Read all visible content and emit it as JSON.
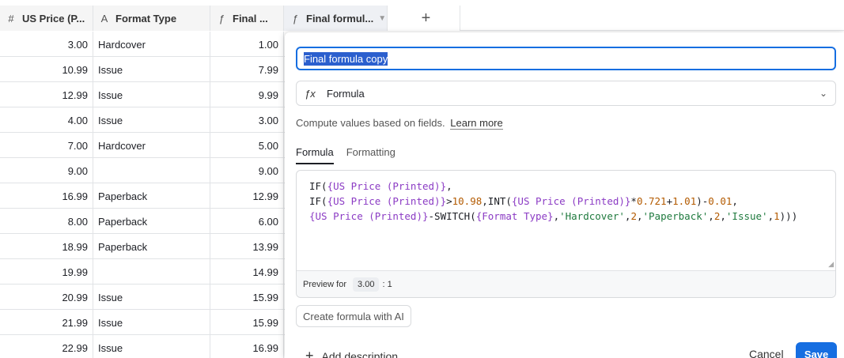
{
  "columns": [
    {
      "icon": "#",
      "label": "US Price (P..."
    },
    {
      "icon": "A",
      "label": "Format Type"
    },
    {
      "icon": "fx",
      "label": "Final ..."
    },
    {
      "icon": "fx",
      "label": "Final formul..."
    }
  ],
  "add_column_label": "+",
  "rows": [
    {
      "price": "3.00",
      "format": "Hardcover",
      "final": "1.00"
    },
    {
      "price": "10.99",
      "format": "Issue",
      "final": "7.99"
    },
    {
      "price": "12.99",
      "format": "Issue",
      "final": "9.99"
    },
    {
      "price": "4.00",
      "format": "Issue",
      "final": "3.00"
    },
    {
      "price": "7.00",
      "format": "Hardcover",
      "final": "5.00"
    },
    {
      "price": "9.00",
      "format": "",
      "final": "9.00"
    },
    {
      "price": "16.99",
      "format": "Paperback",
      "final": "12.99"
    },
    {
      "price": "8.00",
      "format": "Paperback",
      "final": "6.00"
    },
    {
      "price": "18.99",
      "format": "Paperback",
      "final": "13.99"
    },
    {
      "price": "19.99",
      "format": "",
      "final": "14.99"
    },
    {
      "price": "20.99",
      "format": "Issue",
      "final": "15.99"
    },
    {
      "price": "21.99",
      "format": "Issue",
      "final": "15.99"
    },
    {
      "price": "22.99",
      "format": "Issue",
      "final": "16.99"
    }
  ],
  "panel": {
    "field_name": "Final formula copy",
    "field_type": "Formula",
    "description": "Compute values based on fields.",
    "learn_more": "Learn more",
    "tabs": [
      "Formula",
      "Formatting"
    ],
    "formula_lines": [
      "IF({US Price (Printed)},",
      "IF({US Price (Printed)}>10.98,INT({US Price (Printed)}*0.721+1.01)-0.01,",
      "{US Price (Printed)}-SWITCH({Format Type},'Hardcover',2,'Paperback',2,'Issue',1)))"
    ],
    "preview_label": "Preview for",
    "preview_value": "3.00",
    "preview_result": ": 1",
    "ai_button": "Create formula with AI",
    "add_description": "Add description",
    "cancel": "Cancel",
    "save": "Save"
  },
  "colors": {
    "accent": "#166ee1",
    "function": "#8b3bc4",
    "string": "#1f7a3e",
    "number": "#b35a00"
  }
}
